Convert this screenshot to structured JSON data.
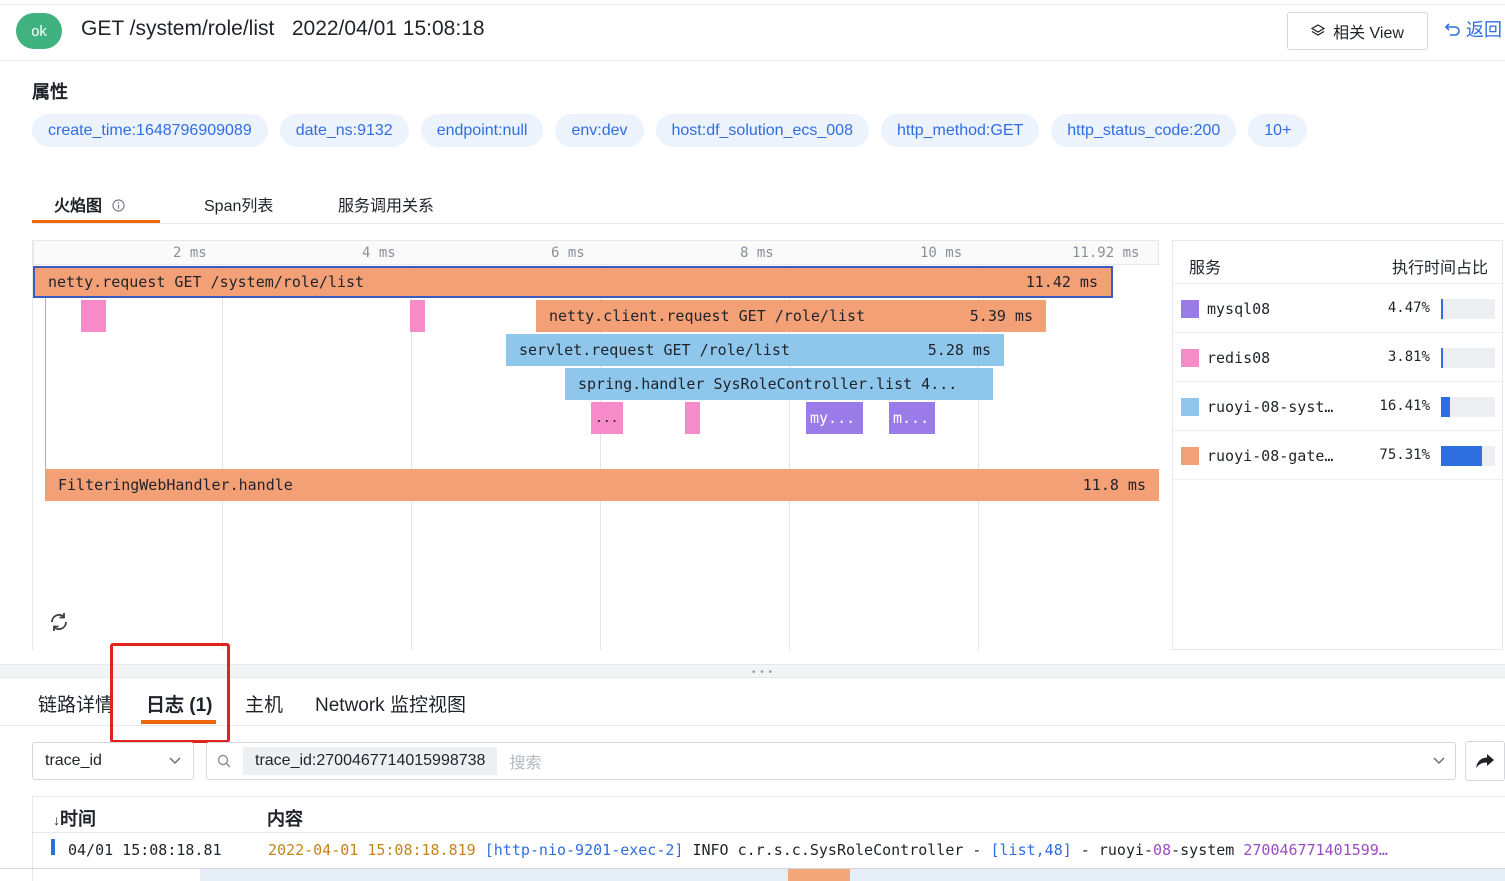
{
  "header": {
    "status": "ok",
    "title": "GET /system/role/list",
    "timestamp": "2022/04/01 15:08:18",
    "related_view_label": "相关 View",
    "back_label": "返回"
  },
  "attributes": {
    "title": "属性",
    "chips": [
      "create_time:1648796909089",
      "date_ns:9132",
      "endpoint:null",
      "env:dev",
      "host:df_solution_ecs_008",
      "http_method:GET",
      "http_status_code:200",
      "10+"
    ]
  },
  "view_tabs": [
    "火焰图",
    "Span列表",
    "服务调用关系"
  ],
  "flame": {
    "ticks": [
      "2 ms",
      "4 ms",
      "6 ms",
      "8 ms",
      "10 ms",
      "11.92 ms"
    ],
    "spans": [
      {
        "label": "netty.request GET /system/role/list",
        "duration": "11.42 ms",
        "service": "gateway"
      },
      {
        "label": "netty.client.request GET /role/list",
        "duration": "5.39 ms",
        "service": "gateway"
      },
      {
        "label": "servlet.request GET /role/list",
        "duration": "5.28 ms",
        "service": "system"
      },
      {
        "label": "spring.handler SysRoleController.list 4...",
        "duration": "",
        "service": "system"
      },
      {
        "label": "...",
        "duration": "",
        "service": "redis"
      },
      {
        "label": "my...",
        "duration": "",
        "service": "mysql"
      },
      {
        "label": "m...",
        "duration": "",
        "service": "mysql"
      },
      {
        "label": "FilteringWebHandler.handle",
        "duration": "11.8 ms",
        "service": "gateway"
      }
    ]
  },
  "services": {
    "col_service": "服务",
    "col_ratio": "执行时间占比",
    "rows": [
      {
        "name": "mysql08",
        "percent": "4.47%",
        "ratio": 0.0447,
        "color": "#9b7be8"
      },
      {
        "name": "redis08",
        "percent": "3.81%",
        "ratio": 0.0381,
        "color": "#f78bca"
      },
      {
        "name": "ruoyi-08-syst…",
        "percent": "16.41%",
        "ratio": 0.1641,
        "color": "#8ec6ec"
      },
      {
        "name": "ruoyi-08-gate…",
        "percent": "75.31%",
        "ratio": 0.7531,
        "color": "#f4a077"
      }
    ]
  },
  "bottom_tabs": [
    "链路详情",
    "日志 (1)",
    "主机",
    "Network 监控视图"
  ],
  "filter": {
    "field": "trace_id",
    "tag": "trace_id:2700467714015998738",
    "placeholder": "搜索"
  },
  "logs": {
    "col_time": "时间",
    "col_content": "内容",
    "rows": [
      {
        "time": "04/01 15:08:18.81",
        "date": "2022-04-01 15:08:18.819",
        "thread": "[http-nio-9201-exec-2]",
        "level_logger": "INFO c.r.s.c.SysRoleController - ",
        "method": "[list,48]",
        "mid": " - ruoyi-",
        "num": "08",
        "svc": "-system ",
        "trace": "270046771401599…"
      }
    ]
  },
  "colors": {
    "gateway": "#f4a077",
    "system": "#8ec6ec",
    "redis": "#f78bca",
    "mysql": "#9b7be8",
    "accent": "#f0660a",
    "link": "#2f6ee0"
  }
}
